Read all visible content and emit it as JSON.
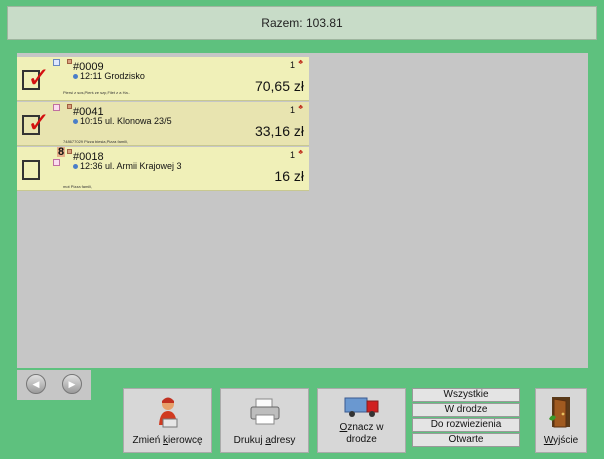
{
  "header": {
    "total_label": "Razem: 103.81"
  },
  "orders": [
    {
      "number": "#0009",
      "time_address": "12:11 Grodzisko",
      "description": "Piersi z sos,Pierś ze szp,Filet z a Ha..",
      "qty": "1",
      "price": "70,65 zł",
      "checked": true,
      "badge": ""
    },
    {
      "number": "#0041",
      "time_address": "10:15 ul. Klonowa  23/5",
      "description": "748677029 Pizza biesia,Pizza famili,",
      "qty": "1",
      "price": "33,16 zł",
      "checked": true,
      "badge": ""
    },
    {
      "number": "#0018",
      "time_address": "12:36 ul. Armii Krajowej 3",
      "description": "mot Pizza famili,",
      "qty": "1",
      "price": "16 zł",
      "checked": false,
      "badge": "8"
    }
  ],
  "actions": {
    "change_driver": {
      "pre": "Zmień ",
      "u": "k",
      "post": "ierowcę",
      "icon": "driver-icon"
    },
    "print_addresses": {
      "pre": "Drukuj ",
      "u": "a",
      "post": "dresy",
      "icon": "printer-icon"
    },
    "mark_on_road": {
      "pre": "",
      "u": "O",
      "post": "znacz w",
      "line2": "drodze",
      "icon": "truck-icon"
    },
    "exit": {
      "pre": "",
      "u": "W",
      "post": "yjście",
      "icon": "door-icon"
    }
  },
  "filters": [
    "Wszystkie",
    "W drodze",
    "Do rozwiezienia",
    "Otwarte"
  ]
}
